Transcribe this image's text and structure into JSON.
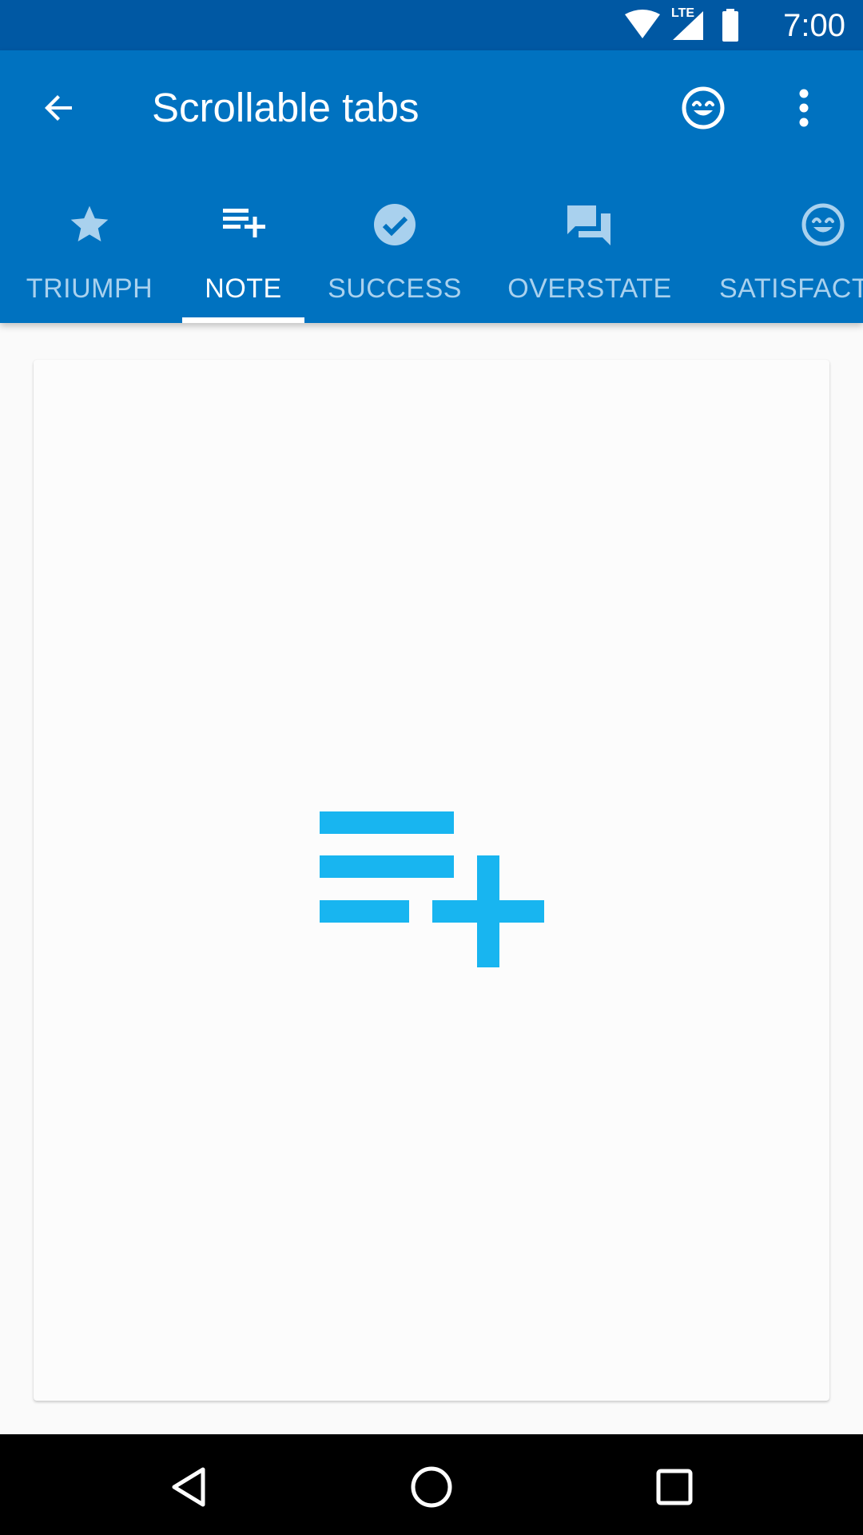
{
  "status_bar": {
    "time": "7:00",
    "network": "LTE",
    "icons": [
      "wifi-icon",
      "signal-icon",
      "battery-icon"
    ]
  },
  "toolbar": {
    "title": "Scrollable tabs",
    "back_icon": "arrow-back-icon",
    "action_icon": "smiley-icon",
    "overflow_icon": "more-vert-icon"
  },
  "tabs": [
    {
      "label": "TRIUMPH",
      "icon": "star-icon",
      "selected": false
    },
    {
      "label": "NOTE",
      "icon": "playlist-add-icon",
      "selected": true
    },
    {
      "label": "SUCCESS",
      "icon": "check-circle-icon",
      "selected": false
    },
    {
      "label": "OVERSTATE",
      "icon": "forum-icon",
      "selected": false
    },
    {
      "label": "SATISFACT",
      "icon": "smiley-icon",
      "selected": false
    }
  ],
  "content": {
    "icon": "playlist-add-icon"
  },
  "navigation_bar": {
    "buttons": [
      "back-triangle-icon",
      "home-circle-icon",
      "recents-square-icon"
    ]
  },
  "colors": {
    "status_bar": "#0058a3",
    "app_bar": "#0072c0",
    "tab_inactive": "#a9d1ee",
    "tab_active": "#ffffff",
    "content_icon": "#18b5f0",
    "nav_bar": "#000000"
  }
}
